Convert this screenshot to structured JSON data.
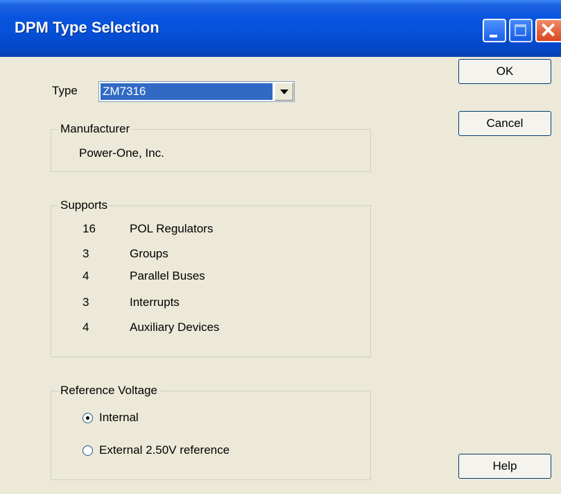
{
  "window": {
    "title": "DPM Type Selection"
  },
  "type_field": {
    "label": "Type",
    "value": "ZM7316"
  },
  "manufacturer": {
    "legend": "Manufacturer",
    "value": "Power-One, Inc."
  },
  "supports": {
    "legend": "Supports",
    "rows": [
      {
        "count": "16",
        "label": "POL Regulators"
      },
      {
        "count": "3",
        "label": "Groups"
      },
      {
        "count": "4",
        "label": "Parallel Buses"
      },
      {
        "count": "3",
        "label": "Interrupts"
      },
      {
        "count": "4",
        "label": "Auxiliary Devices"
      }
    ]
  },
  "reference_voltage": {
    "legend": "Reference Voltage",
    "options": [
      {
        "label": "Internal",
        "selected": true
      },
      {
        "label": "External 2.50V reference",
        "selected": false
      }
    ]
  },
  "buttons": {
    "ok": "OK",
    "cancel": "Cancel",
    "help": "Help"
  },
  "icons": {
    "minimize": "minimize-icon",
    "maximize": "maximize-icon",
    "close": "close-icon"
  },
  "colors": {
    "titlebar": "#0551D8",
    "selection": "#316AC5",
    "close": "#D9451F",
    "dialog": "#ECE9D8"
  }
}
